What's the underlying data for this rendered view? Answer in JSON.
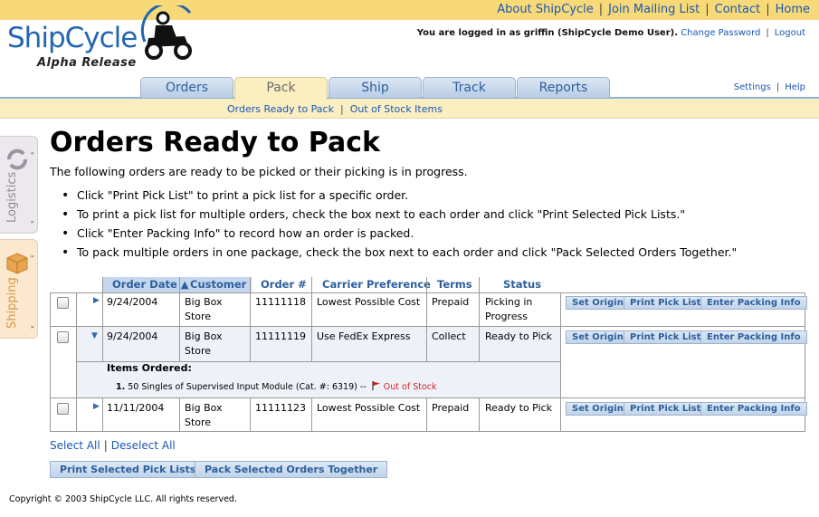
{
  "top_links": [
    "About ShipCycle",
    "Join Mailing List",
    "Contact",
    "Home"
  ],
  "logo": {
    "name": "ShipCycle",
    "subtitle": "Alpha Release"
  },
  "login": {
    "message": "You are logged in as griffin (ShipCycle Demo User).",
    "change_password": "Change Password",
    "logout": "Logout"
  },
  "tabs": [
    "Orders",
    "Pack",
    "Ship",
    "Track",
    "Reports"
  ],
  "active_tab": "Pack",
  "settings_links": [
    "Settings",
    "Help"
  ],
  "subnav": [
    "Orders Ready to Pack",
    "Out of Stock Items"
  ],
  "side_tabs": [
    "Logistics",
    "Shipping"
  ],
  "page": {
    "title": "Orders Ready to Pack",
    "intro": "The following orders are ready to be picked or their picking is in progress.",
    "bullets": [
      "Click \"Print Pick List\" to print a pick list for a specific order.",
      "To print a pick list for multiple orders, check the box next to each order and click \"Print Selected Pick Lists.\"",
      "Click \"Enter Packing Info\" to record how an order is packed.",
      "To pack multiple orders in one package, check the box next to each order and click \"Pack Selected Orders Together.\""
    ]
  },
  "table": {
    "columns": [
      "Order Date ▲",
      "Customer",
      "Order #",
      "Carrier Preference",
      "Terms",
      "Status"
    ],
    "rows": [
      {
        "date": "9/24/2004",
        "customer_1": "Big Box",
        "customer_2": "Store",
        "order": "11111118",
        "carrier": "Lowest Possible Cost",
        "terms": "Prepaid",
        "status_1": "Picking in",
        "status_2": "Progress"
      },
      {
        "date": "9/24/2004",
        "customer_1": "Big Box",
        "customer_2": "Store",
        "order": "11111119",
        "carrier": "Use FedEx Express",
        "terms": "Collect",
        "status_1": "Ready to Pick",
        "status_2": ""
      },
      {
        "date": "11/11/2004",
        "customer_1": "Big Box",
        "customer_2": "Store",
        "order": "11111123",
        "carrier": "Lowest Possible Cost",
        "terms": "Prepaid",
        "status_1": "Ready to Pick",
        "status_2": ""
      }
    ],
    "row_buttons": [
      "Set Origin",
      "Print Pick List",
      "Enter Packing Info"
    ],
    "items_ordered": {
      "title": "Items Ordered:",
      "number": "1.",
      "item": "50 Singles of Supervised Input Module (Cat. #: 6319) --",
      "flag": "Out of Stock"
    }
  },
  "select_all": "Select All",
  "deselect_all": "Deselect All",
  "bulk_buttons": [
    "Print Selected Pick Lists",
    "Pack Selected Orders Together"
  ],
  "copyright": "Copyright © 2003 ShipCycle LLC. All rights reserved.",
  "colors": {
    "header_yellow": "#f7d977",
    "link_blue": "#1b57b4",
    "tab_blue": "#b9cde6",
    "pack_cream": "#fbeec0",
    "out_of_stock_red": "#d62020"
  }
}
